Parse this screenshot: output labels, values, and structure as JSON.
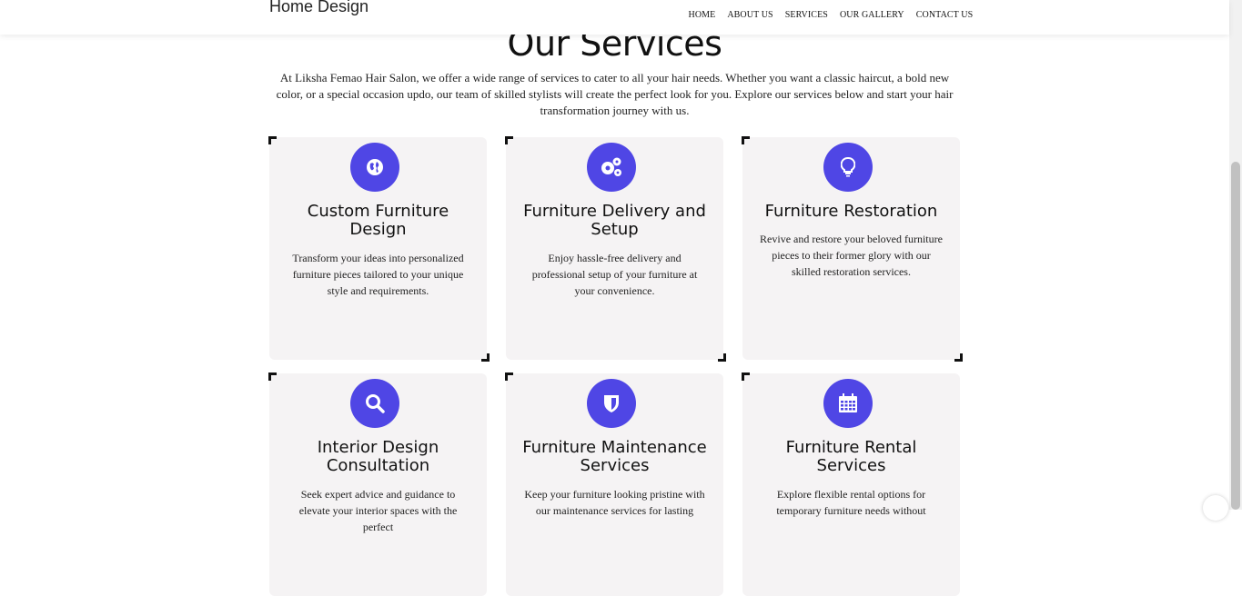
{
  "header": {
    "logo": "Home Design",
    "nav": [
      "HOME",
      "ABOUT US",
      "SERVICES",
      "OUR GALLERY",
      "CONTACT US"
    ]
  },
  "section": {
    "title": "Our Services",
    "intro": "At Liksha Femao Hair Salon, we offer a wide range of services to cater to all your hair needs. Whether you want a classic haircut, a bold new color, or a special occasion updo, our team of skilled stylists will create the perfect look for you. Explore our services below and start your hair transformation journey with us."
  },
  "cards": [
    {
      "icon": "globe-icon",
      "title": "Custom Furniture Design",
      "desc": "Transform your ideas into personalized furniture pieces tailored to your unique style and requirements."
    },
    {
      "icon": "gears-icon",
      "title": "Furniture Delivery and Setup",
      "desc": "Enjoy hassle-free delivery and professional setup of your furniture at your convenience."
    },
    {
      "icon": "lightbulb-icon",
      "title": "Furniture Restoration",
      "desc": "Revive and restore your beloved furniture pieces to their former glory with our skilled restoration services."
    },
    {
      "icon": "search-icon",
      "title": "Interior Design Consultation",
      "desc": "Seek expert advice and guidance to elevate your interior spaces with the perfect"
    },
    {
      "icon": "shield-icon",
      "title": "Furniture Maintenance Services",
      "desc": "Keep your furniture looking pristine with our maintenance services for lasting"
    },
    {
      "icon": "calendar-icon",
      "title": "Furniture Rental Services",
      "desc": "Explore flexible rental options for temporary furniture needs without"
    }
  ],
  "colors": {
    "accent": "#4f46e5",
    "card_bg": "#f5f3f4"
  }
}
